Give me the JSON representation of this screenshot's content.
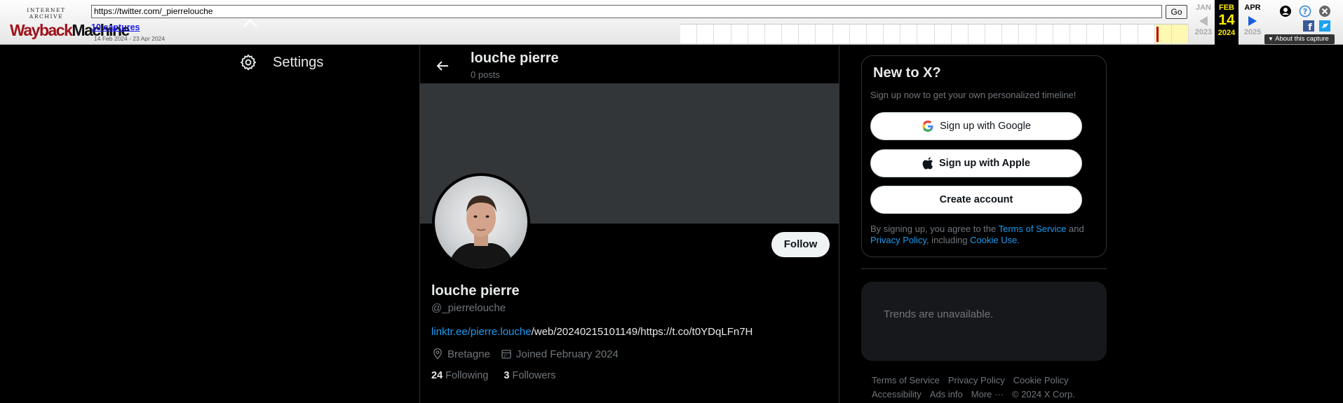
{
  "wayback": {
    "logo_top": "INTERNET ARCHIVE",
    "logo_way": "Wayback",
    "logo_machine": "Machine",
    "url": "https://twitter.com/_pierrelouche",
    "go_label": "Go",
    "captures_label": "10 captures",
    "date_range": "14 Feb 2024 - 23 Apr 2024",
    "prev_month": "JAN",
    "cur_month": "FEB",
    "next_month": "APR",
    "cur_day": "14",
    "prev_year": "2023",
    "cur_year": "2024",
    "next_year": "2025",
    "about_label": "About this capture"
  },
  "nav": {
    "settings_label": "Settings"
  },
  "header": {
    "name": "louche pierre",
    "posts": "0 posts"
  },
  "profile": {
    "follow_label": "Follow",
    "name": "louche pierre",
    "handle": "@_pierrelouche",
    "bio_link": "linktr.ee/pierre.louche",
    "bio_rest": "/web/20240215101149/https://t.co/t0YDqLFn7H",
    "location": "Bretagne",
    "joined": "Joined February 2024",
    "following_count": "24",
    "following_label": "Following",
    "followers_count": "3",
    "followers_label": "Followers"
  },
  "signup": {
    "title": "New to X?",
    "subtitle": "Sign up now to get your own personalized timeline!",
    "google_label": "Sign up with Google",
    "apple_label": "Sign up with Apple",
    "create_label": "Create account",
    "terms_prefix": "By signing up, you agree to the ",
    "terms_link": "Terms of Service",
    "terms_and": " and",
    "privacy_link": "Privacy Policy",
    "including": ", including ",
    "cookie_link": "Cookie Use."
  },
  "trends": {
    "text": "Trends are unavailable."
  },
  "footer": {
    "links": [
      "Terms of Service",
      "Privacy Policy",
      "Cookie Policy",
      "Accessibility",
      "Ads info",
      "More ···",
      "© 2024 X Corp."
    ]
  },
  "colors": {
    "accent": "#1d9bf0",
    "banner": "#333639",
    "wayback_red": "#a0121a"
  }
}
